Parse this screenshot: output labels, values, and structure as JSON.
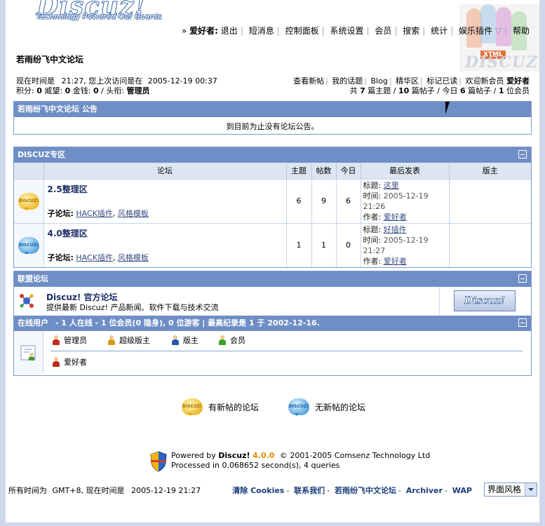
{
  "header": {
    "logo_word": "Discuz!",
    "logo_tagline": "Technology Powered Our Boards",
    "nav_user": "爱好者:",
    "nav": [
      "退出",
      "短消息",
      "控制面板",
      "系统设置",
      "会员",
      "搜索",
      "统计",
      "娱乐插件",
      "帮助"
    ],
    "deco_text": "DISCUZ!",
    "deco_badge": "XTML"
  },
  "forum_name": "若雨纷飞中文论坛",
  "info": {
    "now_label": "现在时间是",
    "now_time": "21:27",
    "last_visit_label": ", 您上次访问是在",
    "last_visit": "2005-12-19 00:37",
    "points_label": "积分:",
    "points": "0",
    "prestige_label": "威望:",
    "prestige": "0",
    "money_label": "金钱:",
    "money": "0",
    "title_label": "/ 头衔:",
    "title": "管理员",
    "links": [
      "查看新帖",
      "我的话题",
      "Blog",
      "精华区",
      "标记已读"
    ],
    "welcome_label": "欢迎新会员",
    "welcome_user": "爱好者",
    "stats_total": "共",
    "stats_topics": "7",
    "stats_topics_label": "篇主题",
    "stats_posts": "10",
    "stats_posts_label": "篇帖子",
    "stats_today_label": "今日",
    "stats_today": "6",
    "stats_today_posts_label": "篇帖子",
    "stats_members": "1",
    "stats_members_label": "位会员"
  },
  "announce": {
    "title": "若雨纷飞中文论坛 公告",
    "text": "到目前为止没有论坛公告。"
  },
  "category": {
    "title": "DISCUZ专区",
    "columns": [
      "论坛",
      "主题",
      "帖数",
      "今日",
      "最后发表",
      "版主"
    ],
    "forums": [
      {
        "name": "2.5整理区",
        "sub_label": "子论坛:",
        "subs": [
          "HACK插件",
          "风格模板"
        ],
        "topics": "6",
        "posts": "9",
        "today": "6",
        "last_title_label": "标题:",
        "last_title": "这里",
        "last_time_label": "时间:",
        "last_time": "2005-12-19 21:26",
        "last_author_label": "作者:",
        "last_author": "爱好者",
        "moderator": "",
        "icon": "new-posts-icon"
      },
      {
        "name": "4.0整理区",
        "sub_label": "子论坛:",
        "subs": [
          "HACK插件",
          "风格模板"
        ],
        "topics": "1",
        "posts": "1",
        "today": "0",
        "last_title_label": "标题:",
        "last_title": "好插件",
        "last_time_label": "时间:",
        "last_time": "2005-12-19 21:27",
        "last_author_label": "作者:",
        "last_author": "爱好者",
        "moderator": "",
        "icon": "no-new-posts-icon"
      }
    ]
  },
  "union": {
    "title": "联盟论坛",
    "name": "Discuz! 官方论坛",
    "desc": "提供最新 Discuz! 产品新闻、软件下载与技术交流",
    "logo": "Discuz!"
  },
  "online": {
    "title": "在线用户",
    "summary": "- 1 人在线 - 1 位会员(0 隐身), 0 位游客 | 最高纪录是 1 于 2002-12-16.",
    "roles": [
      "管理员",
      "超级版主",
      "版主",
      "会员"
    ],
    "users": [
      "爱好者"
    ]
  },
  "legend": {
    "new": "有新帖的论坛",
    "nonew": "无新帖的论坛"
  },
  "footer": {
    "powered_label": "Powered by",
    "product": "Discuz!",
    "version": "4.0.0",
    "copyright": "© 2001-2005 Comsenz Technology Ltd",
    "processed": "Processed in 0.068652 second(s), 4 queries",
    "timezone_label": "所有时间为",
    "timezone": "GMT+8",
    "now_label": ", 现在时间是",
    "now": "2005-12-19 21:27",
    "links": [
      "清除",
      "Cookies",
      "联系我们",
      "若雨纷飞中文论坛",
      "Archiver",
      "WAP"
    ],
    "style_select": "界面风格"
  }
}
